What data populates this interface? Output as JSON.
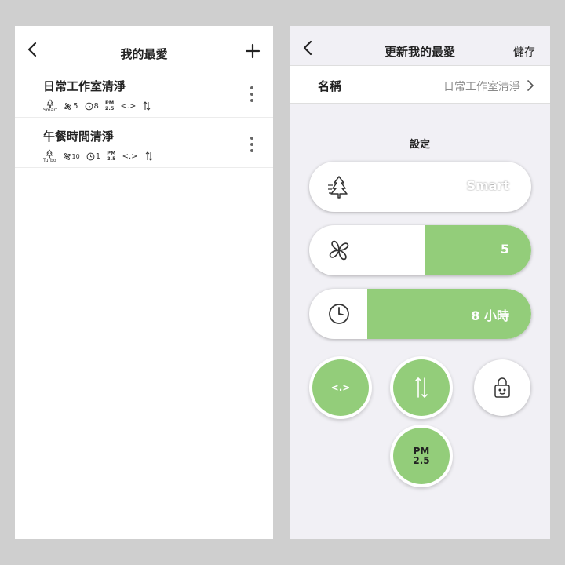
{
  "left_screen": {
    "title": "我的最愛",
    "favorites": [
      {
        "name": "日常工作室清淨",
        "mode_label": "Smart",
        "fan_speed": "5",
        "timer": "8",
        "pm_top": "PM",
        "pm_bottom": "2.5",
        "oscillation": "<.>"
      },
      {
        "name": "午餐時間清淨",
        "mode_label": "Turbo",
        "fan_speed": "10",
        "timer": "1",
        "pm_top": "PM",
        "pm_bottom": "2.5",
        "oscillation": "<.>"
      }
    ]
  },
  "right_screen": {
    "title": "更新我的最愛",
    "save_label": "儲存",
    "name_label": "名稱",
    "name_value": "日常工作室清淨",
    "settings_title": "設定",
    "mode": {
      "value": "Smart"
    },
    "fan": {
      "value": "5",
      "level_fraction": 0.48
    },
    "timer": {
      "value": "8 小時",
      "level_fraction": 0.74
    },
    "buttons": {
      "oscillation": {
        "label": "<.>",
        "active": true
      },
      "vertical_airflow": {
        "active": true
      },
      "child_lock": {
        "active": false
      },
      "pm_mode": {
        "top": "PM",
        "bottom": "2.5",
        "active": true
      }
    }
  },
  "colors": {
    "accent_green": "#93cd7a",
    "background": "#cfcfcf",
    "panel": "#f1f0f5",
    "text_muted": "#8a8a8a"
  }
}
